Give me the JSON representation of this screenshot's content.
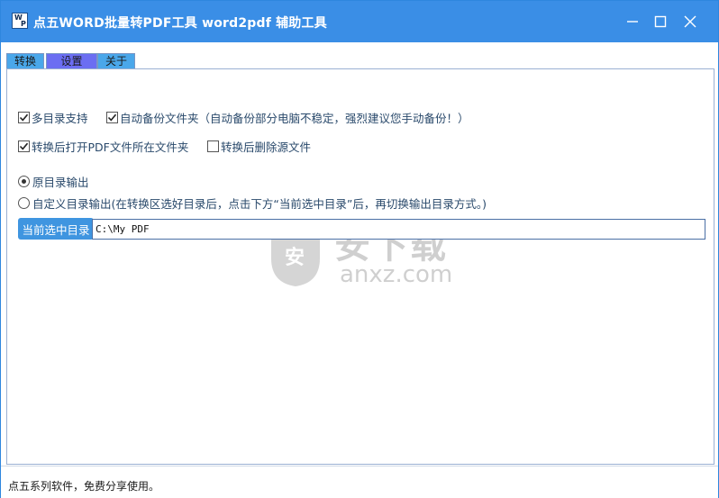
{
  "window": {
    "title": "点五WORD批量转PDF工具 word2pdf 辅助工具",
    "icon_text": [
      "W",
      "P"
    ]
  },
  "tabs": [
    {
      "label": "转换",
      "active": false
    },
    {
      "label": "设置",
      "active": true
    },
    {
      "label": "关于",
      "active": false
    }
  ],
  "settings": {
    "multi_dir": {
      "label": "多目录支持",
      "checked": true
    },
    "auto_backup": {
      "label": "自动备份文件夹（自动备份部分电脑不稳定，强烈建议您手动备份！）",
      "checked": true
    },
    "open_pdf_folder": {
      "label": "转换后打开PDF文件所在文件夹",
      "checked": true
    },
    "delete_source": {
      "label": "转换后删除源文件",
      "checked": false
    },
    "output_original": {
      "label": "原目录输出",
      "selected": true
    },
    "output_custom": {
      "label": "自定义目录输出(在转换区选好目录后，点击下方“当前选中目录”后，再切换输出目录方式。)",
      "selected": false
    },
    "current_dir_button": "当前选中目录",
    "current_dir_value": "C:\\My PDF"
  },
  "watermark": {
    "text": "安下载",
    "subtext": "anxz.com",
    "badge": "安"
  },
  "status_bar": {
    "text": "点五系列软件，免费分享使用。"
  },
  "colors": {
    "titlebar": "#3a8ee6",
    "active_tab": "#6b6ef2",
    "inactive_tab": "#4aa7ea",
    "button": "#3f95e0"
  }
}
